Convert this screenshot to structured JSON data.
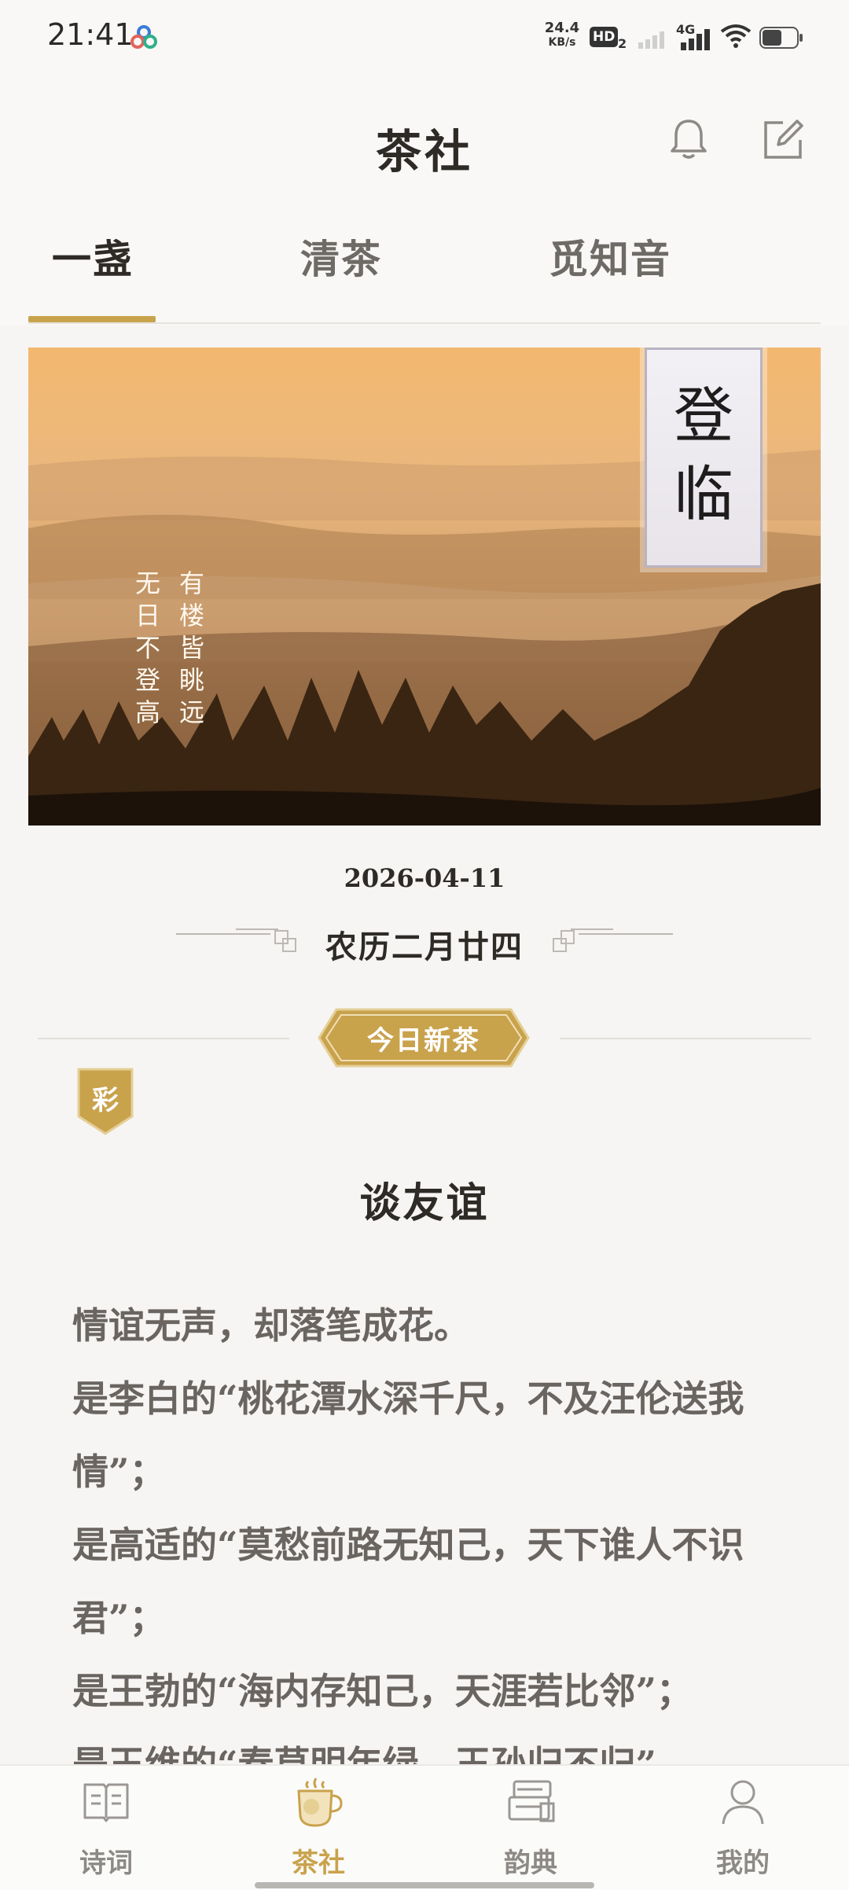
{
  "status_bar": {
    "time": "21:41",
    "speed_value": "24.4",
    "speed_unit": "KB/s",
    "hd_label": "HD",
    "hd_sub": "2",
    "network": "4G",
    "icons": [
      "app-cloud-icon",
      "signal-icon",
      "wifi-icon",
      "battery-icon"
    ]
  },
  "header": {
    "title": "茶社",
    "icons": [
      "bell-icon",
      "edit-icon"
    ]
  },
  "tabs": [
    {
      "label": "一盏",
      "active": true
    },
    {
      "label": "清茶",
      "active": false
    },
    {
      "label": "觅知音",
      "active": false
    }
  ],
  "banner": {
    "title_chars": [
      "登",
      "临"
    ],
    "verse_right": "有楼皆眺远",
    "verse_left": "无日不登高"
  },
  "date": {
    "solar": "2026-04-11",
    "lunar": "农历二月廿四"
  },
  "section": {
    "badge": "今日新茶",
    "tag": "彩"
  },
  "article": {
    "title": "谈友谊",
    "paragraphs": [
      "情谊无声，却落笔成花。",
      "是李白的“桃花潭水深千尺，不及汪伦送我情”；",
      "是高适的“莫愁前路无知己，天下谁人不识君”；",
      "是王勃的“海内存知己，天涯若比邻”；",
      "是王维的“春草明年绿，王孙归不归”……"
    ]
  },
  "bottom_nav": [
    {
      "label": "诗词",
      "icon": "book-icon",
      "active": false
    },
    {
      "label": "茶社",
      "icon": "tea-cup-icon",
      "active": true
    },
    {
      "label": "韵典",
      "icon": "scroll-icon",
      "active": false
    },
    {
      "label": "我的",
      "icon": "user-icon",
      "active": false
    }
  ],
  "colors": {
    "accent": "#c9a24c",
    "background": "#f6f5f3",
    "text": "#2e2a26",
    "muted": "#8d8a86"
  }
}
